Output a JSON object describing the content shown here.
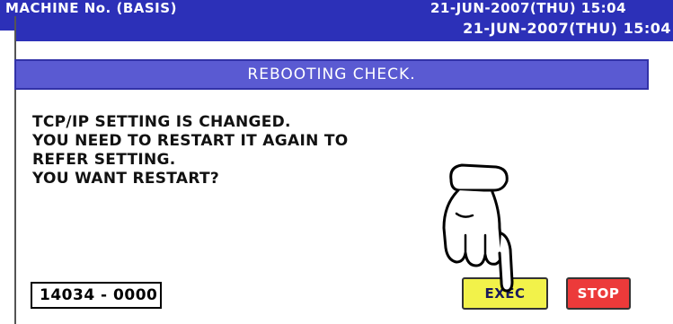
{
  "background_window": {
    "title": "MACHINE No. (BASIS)",
    "datetime": "21-JUN-2007(THU) 15:04"
  },
  "dialog": {
    "datetime": "21-JUN-2007(THU) 15:04",
    "header": "REBOOTING CHECK.",
    "message_lines": [
      "TCP/IP SETTING IS CHANGED.",
      "YOU NEED TO RESTART IT AGAIN TO",
      "REFER SETTING.",
      "YOU WANT RESTART?"
    ],
    "code": "14034 - 0000",
    "exec_label": "EXEC",
    "stop_label": "STOP"
  },
  "colors": {
    "title_bar": "#2c30b8",
    "header_strip": "#5a5ad2",
    "exec_button": "#f2f24a",
    "stop_button": "#ec3a3a"
  },
  "icons": {
    "pointer": "pointing-hand-icon"
  }
}
